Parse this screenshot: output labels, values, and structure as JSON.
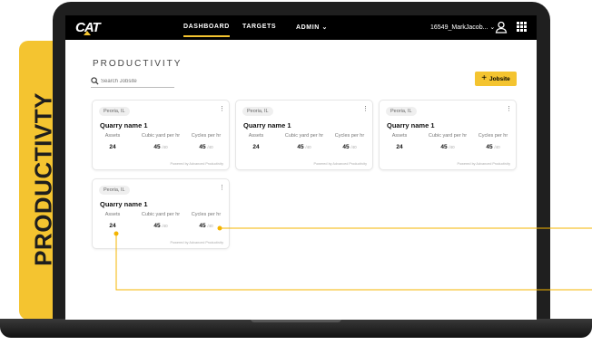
{
  "side_tab": {
    "label": "PRODUCTIVTY"
  },
  "nav": {
    "logo": "CAT",
    "items": [
      "DASHBOARD",
      "TARGETS",
      "ADMIN ⌄"
    ],
    "user": "16549_MarkJacob... ⌄"
  },
  "page": {
    "title": "PRODUCTIVITY"
  },
  "search": {
    "placeholder": "Search Jobsite"
  },
  "add_button": {
    "label": "Jobsite",
    "icon": "plus-icon"
  },
  "colors": {
    "accent": "#f4c430",
    "nav_bg": "#000000",
    "callout": "#f4b400"
  },
  "cards": [
    {
      "location": "Peoria, IL",
      "name": "Quarry name 1",
      "columns": [
        {
          "label": "Assets",
          "value": "24",
          "sub": ""
        },
        {
          "label": "Cubic yard per hr",
          "value": "45",
          "sub": "/40"
        },
        {
          "label": "Cycles per hr",
          "value": "45",
          "sub": "/40"
        }
      ],
      "powered": "Powered by Advanced Productivity"
    },
    {
      "location": "Peoria, IL",
      "name": "Quarry name 1",
      "columns": [
        {
          "label": "Assets",
          "value": "24",
          "sub": ""
        },
        {
          "label": "Cubic yard per hr",
          "value": "45",
          "sub": "/40"
        },
        {
          "label": "Cycles per hr",
          "value": "45",
          "sub": "/40"
        }
      ],
      "powered": "Powered by Advanced Productivity"
    },
    {
      "location": "Peoria, IL",
      "name": "Quarry name 1",
      "columns": [
        {
          "label": "Assets",
          "value": "24",
          "sub": ""
        },
        {
          "label": "Cubic yard per hr",
          "value": "45",
          "sub": "/40"
        },
        {
          "label": "Cycles per hr",
          "value": "45",
          "sub": "/40"
        }
      ],
      "powered": "Powered by Advanced Productivity"
    },
    {
      "location": "Peoria, IL",
      "name": "Quarry name 1",
      "columns": [
        {
          "label": "Assets",
          "value": "24",
          "sub": ""
        },
        {
          "label": "Cubic yard per hr",
          "value": "45",
          "sub": "/40"
        },
        {
          "label": "Cycles per hr",
          "value": "45",
          "sub": "/40"
        }
      ],
      "powered": "Powered by Advanced Productivity"
    }
  ]
}
